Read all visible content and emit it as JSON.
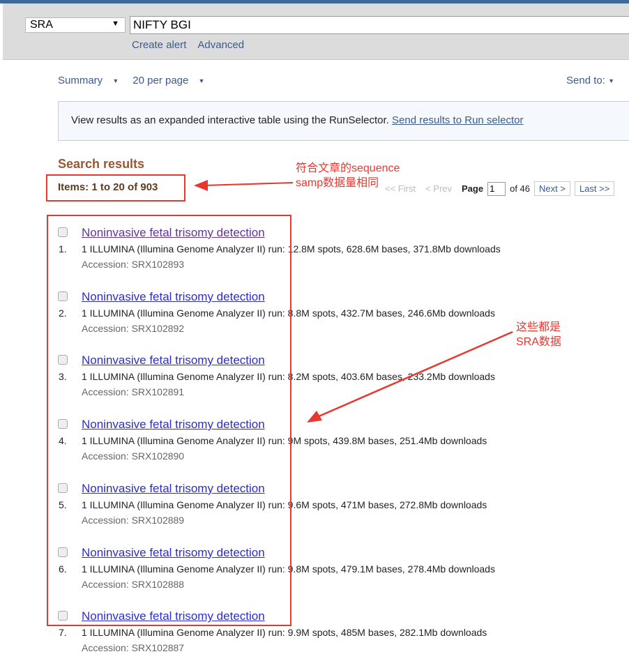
{
  "search": {
    "database": "SRA",
    "query": "NIFTY BGI",
    "create_alert": "Create alert",
    "advanced": "Advanced"
  },
  "options": {
    "format": "Summary",
    "per_page": "20 per page",
    "send_to": "Send to:"
  },
  "notice": {
    "text": "View results as an expanded interactive table using the RunSelector.",
    "link": "Send results to Run selector"
  },
  "results_header": {
    "title": "Search results",
    "items": "Items: 1 to 20 of 903"
  },
  "pager": {
    "first": "<< First",
    "prev": "< Prev",
    "page_label": "Page",
    "page": "1",
    "of": "of 46",
    "next": "Next >",
    "last": "Last >>"
  },
  "results": [
    {
      "num": "1.",
      "title": "Noninvasive fetal trisomy detection",
      "desc": "1 ILLUMINA (Illumina Genome Analyzer II) run: 12.8M spots, 628.6M bases, 371.8Mb downloads",
      "accession": "Accession: SRX102893",
      "visited": true
    },
    {
      "num": "2.",
      "title": "Noninvasive fetal trisomy detection",
      "desc": "1 ILLUMINA (Illumina Genome Analyzer II) run: 8.8M spots, 432.7M bases, 246.6Mb downloads",
      "accession": "Accession: SRX102892"
    },
    {
      "num": "3.",
      "title": "Noninvasive fetal trisomy detection",
      "desc": "1 ILLUMINA (Illumina Genome Analyzer II) run: 8.2M spots, 403.6M bases, 233.2Mb downloads",
      "accession": "Accession: SRX102891"
    },
    {
      "num": "4.",
      "title": "Noninvasive fetal trisomy detection",
      "desc": "1 ILLUMINA (Illumina Genome Analyzer II) run: 9M spots, 439.8M bases, 251.4Mb downloads",
      "accession": "Accession: SRX102890"
    },
    {
      "num": "5.",
      "title": "Noninvasive fetal trisomy detection",
      "desc": "1 ILLUMINA (Illumina Genome Analyzer II) run: 9.6M spots, 471M bases, 272.8Mb downloads",
      "accession": "Accession: SRX102889"
    },
    {
      "num": "6.",
      "title": "Noninvasive fetal trisomy detection",
      "desc": "1 ILLUMINA (Illumina Genome Analyzer II) run: 9.8M spots, 479.1M bases, 278.4Mb downloads",
      "accession": "Accession: SRX102888"
    },
    {
      "num": "7.",
      "title": "Noninvasive fetal trisomy detection",
      "desc": "1 ILLUMINA (Illumina Genome Analyzer II) run: 9.9M spots, 485M bases, 282.1Mb downloads",
      "accession": "Accession: SRX102887"
    }
  ],
  "annotations": {
    "note1_line1": "符合文章的sequence",
    "note1_line2": "samp数据量相同",
    "note2_line1": "这些都是",
    "note2_line2": "SRA数据",
    "color": "#e8372f"
  }
}
